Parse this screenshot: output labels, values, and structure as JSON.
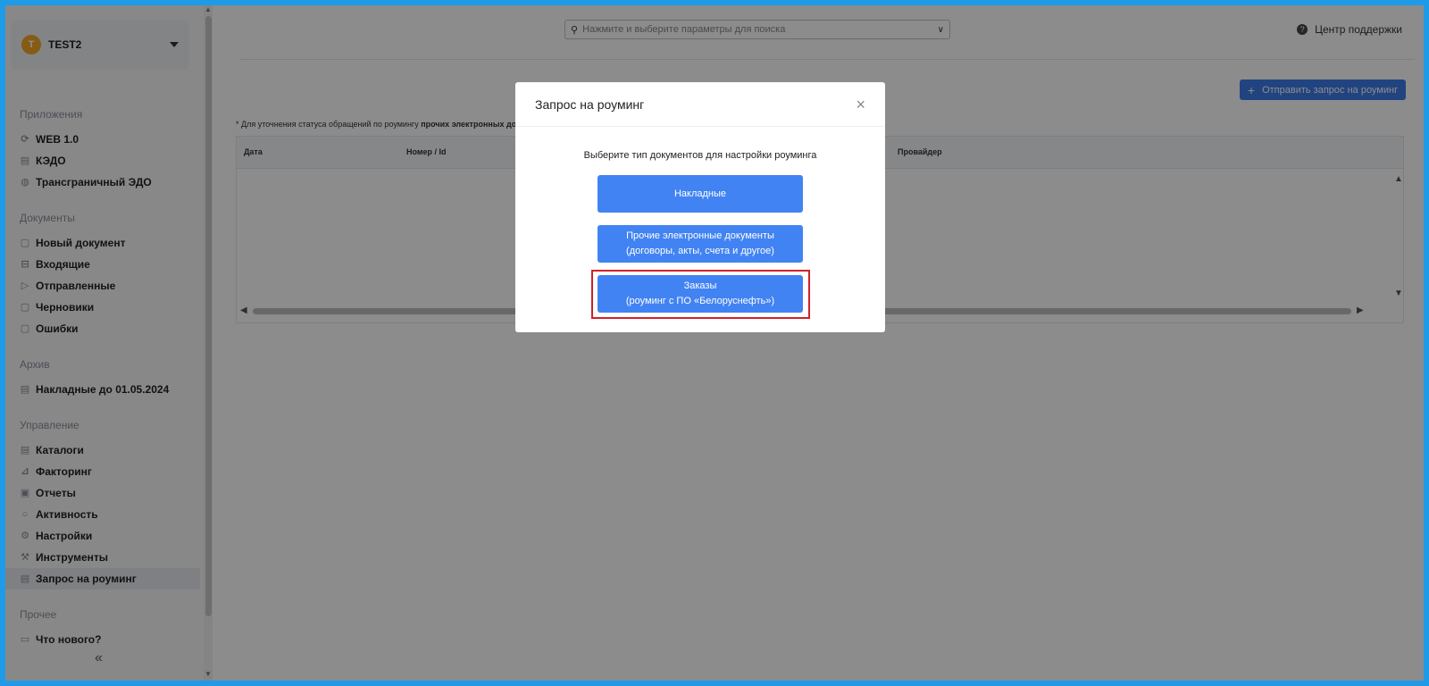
{
  "org": {
    "initial": "T",
    "name": "TEST2"
  },
  "sidebar": {
    "sections": [
      {
        "title": "Приложения",
        "items": [
          "WEB 1.0",
          "КЭДО",
          "Трансграничный ЭДО"
        ]
      },
      {
        "title": "Документы",
        "items": [
          "Новый документ",
          "Входящие",
          "Отправленные",
          "Черновики",
          "Ошибки"
        ]
      },
      {
        "title": "Архив",
        "items": [
          "Накладные до 01.05.2024"
        ]
      },
      {
        "title": "Управление",
        "items": [
          "Каталоги",
          "Факторинг",
          "Отчеты",
          "Активность",
          "Настройки",
          "Инструменты",
          "Запрос на роуминг"
        ]
      },
      {
        "title": "Прочее",
        "items": [
          "Что нового?"
        ]
      }
    ],
    "collapse_icon": "«"
  },
  "header": {
    "search_placeholder": "Нажмите и выберите параметры для поиска",
    "help_label": "Центр поддержки"
  },
  "toolbar": {
    "send_label": "Отправить запрос на роуминг"
  },
  "note": {
    "prefix": "* Для уточнения статуса обращений по роумингу ",
    "bold": "прочих электронных до"
  },
  "table": {
    "columns": [
      "Дата",
      "Номер / Id",
      "Провайдер"
    ]
  },
  "modal": {
    "title": "Запрос на роуминг",
    "subtitle": "Выберите тип документов для настройки роуминга",
    "btn1": "Накладные",
    "btn2_line1": "Прочие электронные документы",
    "btn2_line2": "(договоры, акты, счета и другое)",
    "btn3_line1": "Заказы",
    "btn3_line2": "(роуминг с ПО «Белоруснефть»)"
  },
  "colors": {
    "accent": "#4283f3",
    "highlight": "#d0202a",
    "frame": "#1e9be8"
  }
}
